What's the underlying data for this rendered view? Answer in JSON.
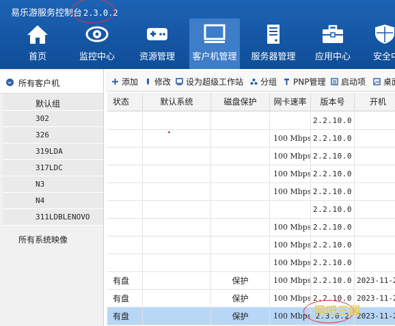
{
  "app": {
    "title": "易乐游服务控制台",
    "version": "2.3.0.2"
  },
  "nav": {
    "items": [
      {
        "label": "首页",
        "icon": "home-icon"
      },
      {
        "label": "监控中心",
        "icon": "eye-icon"
      },
      {
        "label": "资源管理",
        "icon": "gamepad-icon"
      },
      {
        "label": "客户机管理",
        "icon": "monitor-icon",
        "active": true
      },
      {
        "label": "服务器管理",
        "icon": "server-icon"
      },
      {
        "label": "应用中心",
        "icon": "toolbox-icon"
      },
      {
        "label": "安全中",
        "icon": "shield-icon"
      }
    ]
  },
  "sidebar": {
    "root": "所有客户机",
    "groups": [
      "默认组",
      "302",
      "326",
      "319LDA",
      "317LDC",
      "N3",
      "N4",
      "311LDBLENOVO"
    ],
    "images": "所有系统映像"
  },
  "toolbar": {
    "add": "添加",
    "edit": "修改",
    "super": "设为超级工作站",
    "group": "分组",
    "pnp": "PNP管理",
    "startup": "启动项",
    "desktop": "桌面"
  },
  "table": {
    "headers": [
      "状态",
      "默认系统",
      "磁盘保护",
      "网卡速率",
      "版本号",
      "开机"
    ],
    "rows": [
      {
        "status": "",
        "system": "",
        "disk": "",
        "nic": "",
        "version": "2.2.10.0",
        "boot": ""
      },
      {
        "status": "",
        "system": "",
        "disk": "",
        "nic": "100 Mbps",
        "version": "2.2.10.0",
        "boot": ""
      },
      {
        "status": "",
        "system": "",
        "disk": "",
        "nic": "100 Mbps",
        "version": "2.2.10.0",
        "boot": ""
      },
      {
        "status": "",
        "system": "",
        "disk": "",
        "nic": "100 Mbps",
        "version": "2.2.10.0",
        "boot": ""
      },
      {
        "status": "",
        "system": "",
        "disk": "",
        "nic": "100 Mbps",
        "version": "2.2.10.0",
        "boot": ""
      },
      {
        "status": "",
        "system": "",
        "disk": "",
        "nic": "",
        "version": "2.2.10.0",
        "boot": ""
      },
      {
        "status": "",
        "system": "",
        "disk": "",
        "nic": "100 Mbps",
        "version": "2.2.10.0",
        "boot": ""
      },
      {
        "status": "",
        "system": "",
        "disk": "",
        "nic": "100 Mbps",
        "version": "2.2.10.0",
        "boot": ""
      },
      {
        "status": "",
        "system": "",
        "disk": "",
        "nic": "100 Mbps",
        "version": "2.2.10.0",
        "boot": ""
      },
      {
        "status": "有盘",
        "system": "",
        "disk": "保护",
        "nic": "100 Mbps",
        "version": "2.2.10.0",
        "boot": "2023-11-2"
      },
      {
        "status": "有盘",
        "system": "",
        "disk": "保护",
        "nic": "100 Mbps",
        "version": "2.2.10.0",
        "boot": "2023-11-2"
      },
      {
        "status": "有盘",
        "system": "",
        "disk": "保护",
        "nic": "100 Mbps",
        "version": "2.3.0.2",
        "boot": "2023-11-2",
        "selected": true
      }
    ]
  },
  "watermark": "网吧三国",
  "colors": {
    "header": "#1559a9",
    "active_nav": "#3e7dc8",
    "selected_row": "#b8d6f6",
    "annotation": "#e0343c"
  }
}
